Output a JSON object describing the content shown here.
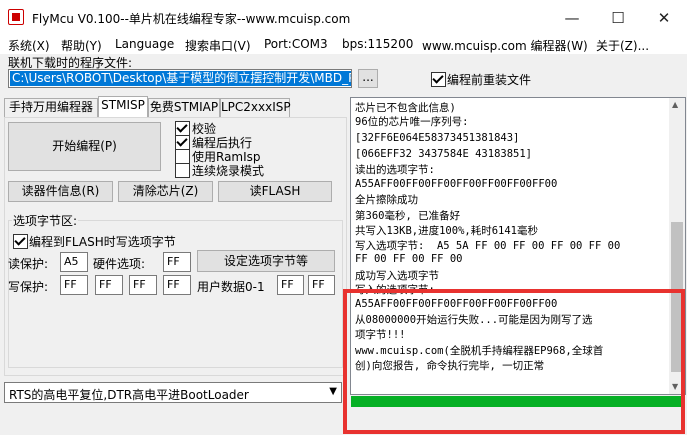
{
  "window": {
    "title": "FlyMcu V0.100--单片机在线编程专家--www.mcuisp.com"
  },
  "menu": [
    "系统(X)",
    "帮助(Y)",
    "Language",
    "搜索串口(V)",
    "Port:COM3",
    "bps:115200",
    "www.mcuisp.com 编程器(W)",
    "关于(Z)..."
  ],
  "file": {
    "label": "联机下载时的程序文件:",
    "path": "C:\\Users\\ROBOT\\Desktop\\基于模型的倒立摆控制开发\\MBD_Pendulu",
    "browse": "...",
    "reload_label": "编程前重装文件",
    "reload_checked": true
  },
  "tabs": [
    "手持万用编程器",
    "STMISP",
    "免费STMIAP",
    "LPC2xxxISP"
  ],
  "active_tab": 1,
  "stmisp": {
    "start_button": "开始编程(P)",
    "checks": [
      {
        "label": "校验",
        "checked": true
      },
      {
        "label": "编程后执行",
        "checked": true
      },
      {
        "label": "使用RamIsp",
        "checked": false
      },
      {
        "label": "连续烧录模式",
        "checked": false
      }
    ],
    "read_info": "读器件信息(R)",
    "erase": "清除芯片(Z)",
    "read_flash": "读FLASH",
    "options_group": "选项字节区:",
    "write_options": "编程到FLASH时写选项字节",
    "write_options_checked": true,
    "read_protect_label": "读保护:",
    "read_protect": "A5",
    "hw_option_label": "硬件选项:",
    "hw_option": "FF",
    "set_option_button": "设定选项字节等",
    "write_protect_label": "写保护:",
    "write_protect": [
      "FF",
      "FF",
      "FF",
      "FF"
    ],
    "user_data_label": "用户数据0-1",
    "user_data": [
      "FF",
      "FF"
    ]
  },
  "bootmode": "RTS的高电平复位,DTR高电平进BootLoader",
  "log": [
    "芯片已不包含此信息)",
    "96位的芯片唯一序列号:",
    "[32FF6E064E58373451381843]",
    "[066EFF32 3437584E 43183851]",
    "读出的选项字节:",
    "A55AFF00FF00FF00FF00FF00FF00FF00",
    "全片擦除成功",
    "第360毫秒, 已准备好",
    "共写入13KB,进度100%,耗时6141毫秒",
    "写入选项字节:  A5 5A FF 00 FF 00 FF 00 FF 00",
    "FF 00 FF 00 FF 00",
    "成功写入选项字节",
    "写入的选项字节:",
    "A55AFF00FF00FF00FF00FF00FF00FF00",
    "从08000000开始运行失败...可能是因为刚写了选",
    "项字节!!!",
    "www.mcuisp.com(全脱机手持编程器EP968,全球首",
    "创)向您报告, 命令执行完毕, 一切正常"
  ],
  "progress": 1.0,
  "colors": {
    "progress": "#06b025",
    "highlight": "#e8322f",
    "selection": "#0078d7"
  }
}
